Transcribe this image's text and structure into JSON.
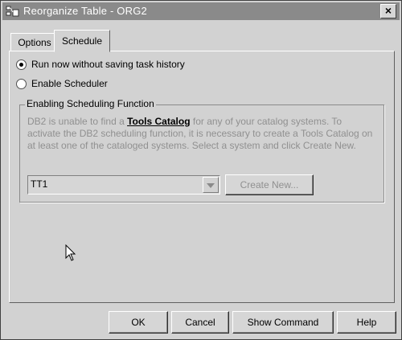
{
  "window": {
    "title": "Reorganize Table - ORG2",
    "close_label": "×"
  },
  "tabs": [
    {
      "label": "Options"
    },
    {
      "label": "Schedule"
    }
  ],
  "schedule": {
    "radio_run_now": "Run now without saving task history",
    "radio_enable": "Enable Scheduler",
    "group_title": "Enabling Scheduling Function",
    "desc_before": "DB2 is unable to find a ",
    "desc_link": "Tools Catalog",
    "desc_after": " for any of your catalog systems. To activate the DB2 scheduling function, it is necessary to create a Tools Catalog on at least one of the cataloged systems. Select a system and click Create New.",
    "system_value": "TT1",
    "create_new_label": "Create New..."
  },
  "buttons": {
    "ok": "OK",
    "cancel": "Cancel",
    "show_command": "Show Command",
    "help": "Help"
  }
}
